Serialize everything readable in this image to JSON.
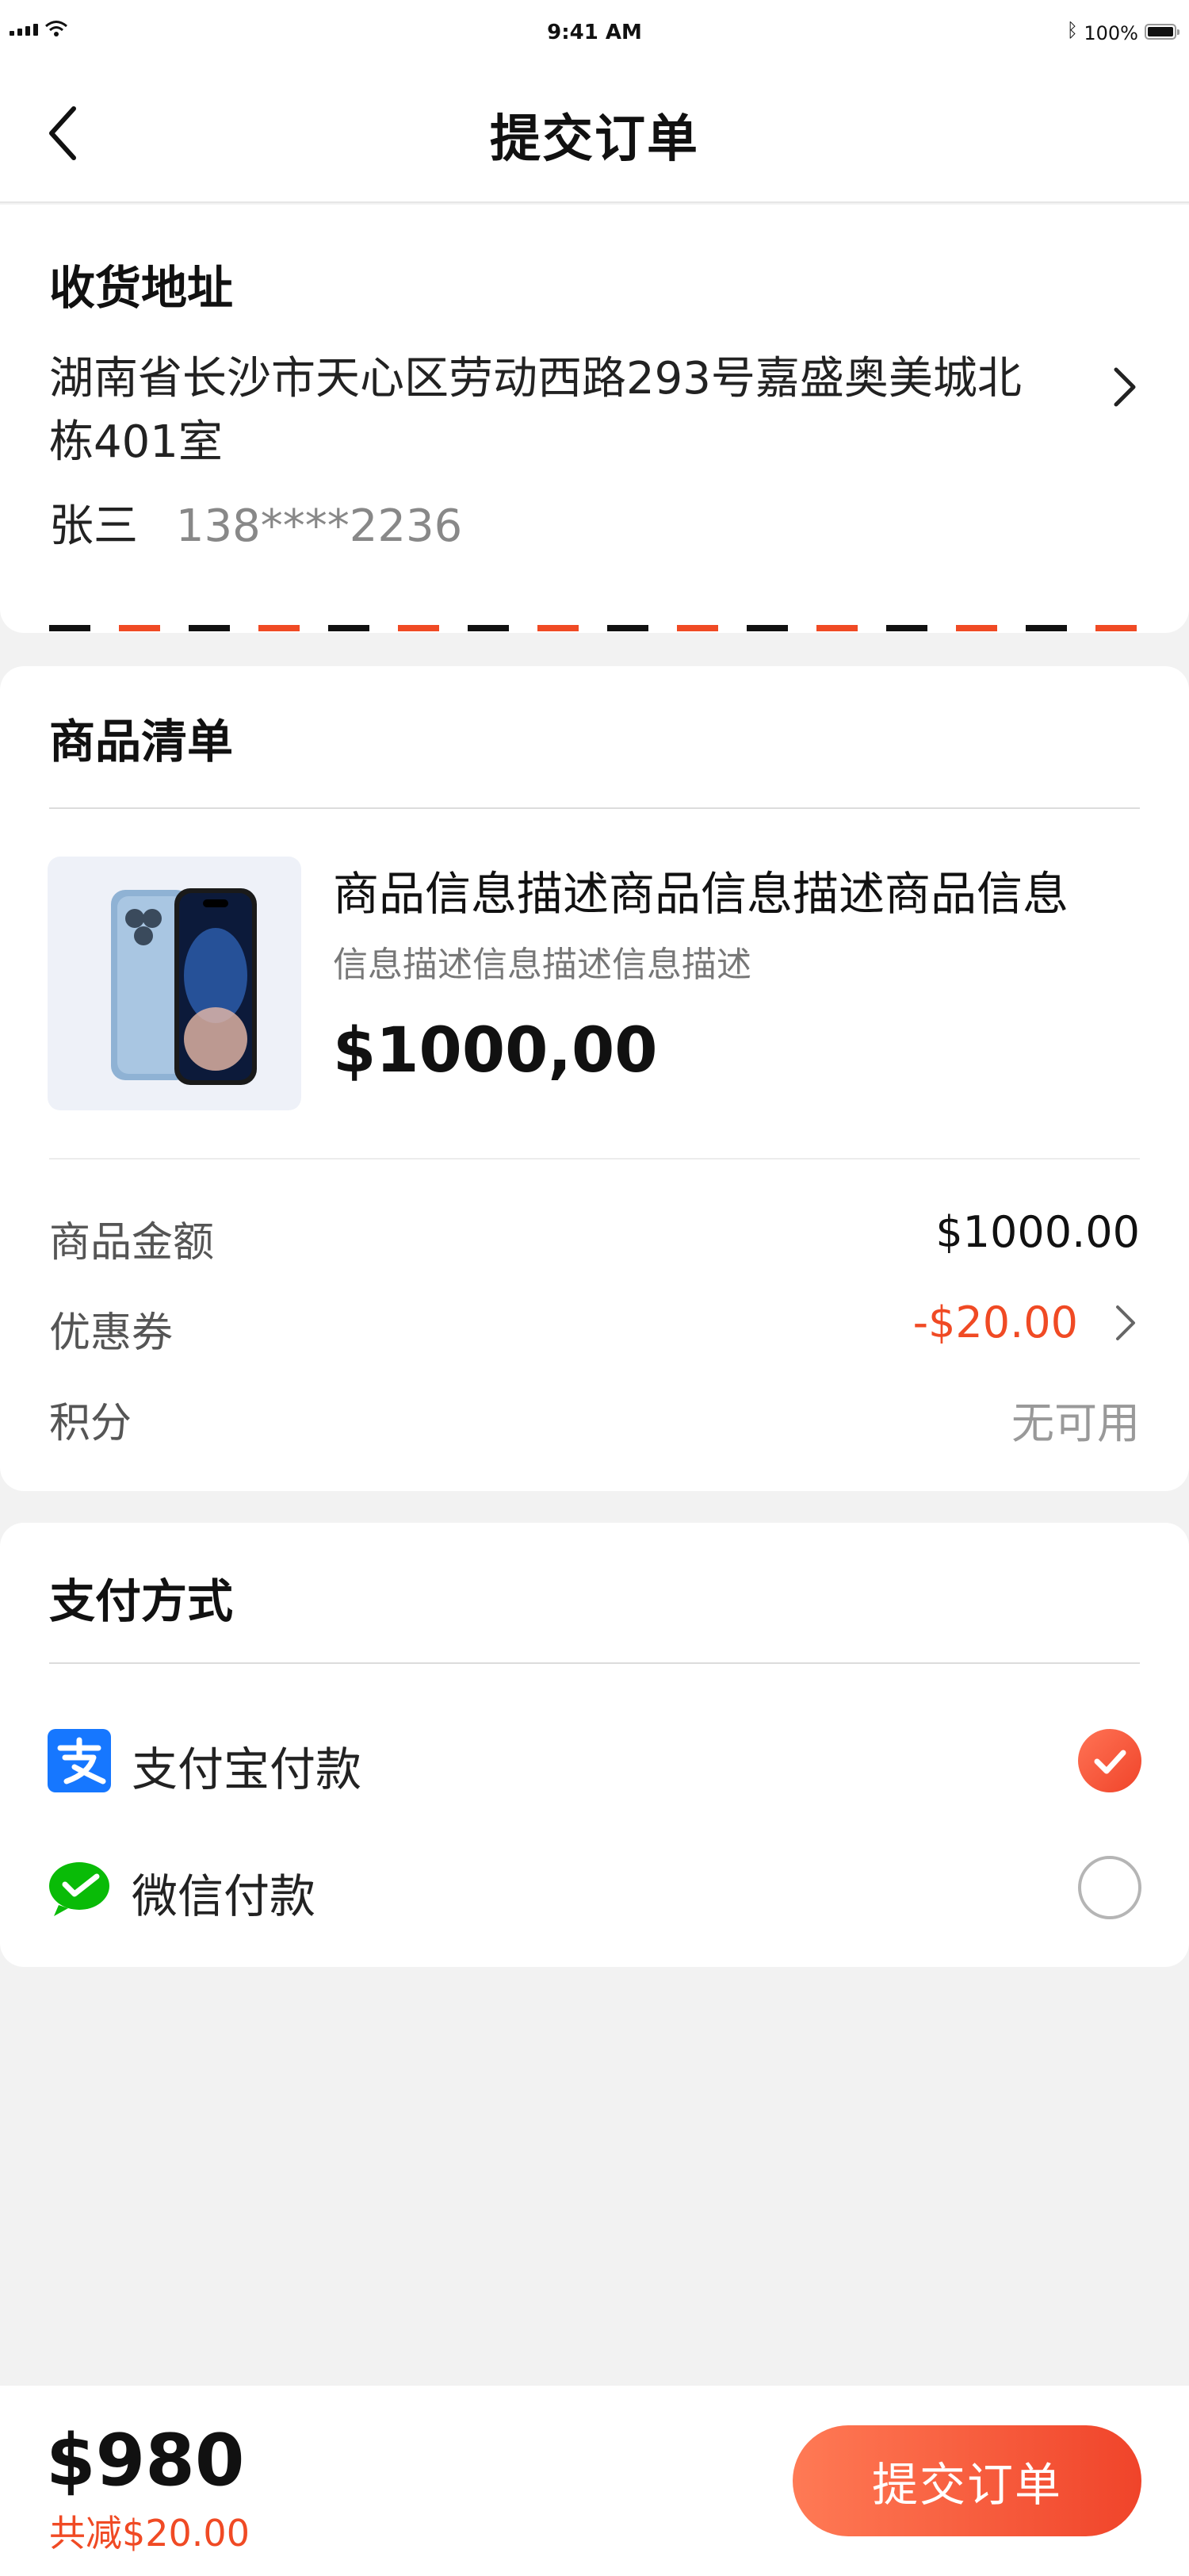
{
  "status_bar": {
    "time": "9:41 AM",
    "battery": "100%"
  },
  "nav": {
    "title": "提交订单"
  },
  "address": {
    "title": "收货地址",
    "line": "湖南省长沙市天心区劳动西路293号嘉盛奥美城北栋401室",
    "name": "张三",
    "phone": "138****2236"
  },
  "goods": {
    "title": "商品清单",
    "item": {
      "name": "商品信息描述商品信息描述商品信息",
      "desc": "信息描述信息描述信息描述",
      "price": "$1000,00"
    },
    "rows": [
      {
        "label": "商品金额",
        "value": "$1000.00"
      },
      {
        "label": "优惠券",
        "value": "-$20.00"
      },
      {
        "label": "积分",
        "value": "无可用"
      }
    ]
  },
  "payment": {
    "title": "支付方式",
    "methods": [
      {
        "label": "支付宝付款",
        "icon": "alipay-icon",
        "selected": true
      },
      {
        "label": "微信付款",
        "icon": "wechat-pay-icon",
        "selected": false
      }
    ]
  },
  "footer": {
    "total": "$980",
    "discount": "共减$20.00",
    "submit_label": "提交订单"
  },
  "colors": {
    "accent": "#f04a24",
    "background": "#f2f2f2"
  }
}
